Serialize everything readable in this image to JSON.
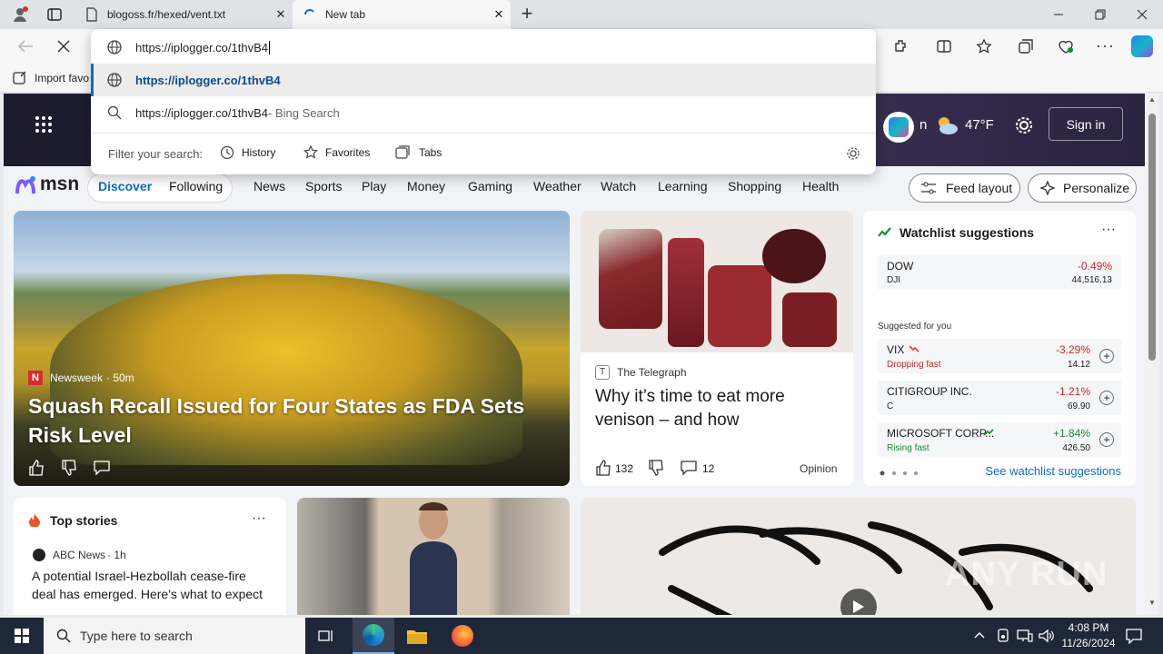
{
  "browser": {
    "tabs": [
      {
        "title": "blogoss.fr/hexed/vent.txt"
      },
      {
        "title": "New tab"
      }
    ],
    "address_text": "https://iplogger.co/1thvB4",
    "suggestions": [
      {
        "text": "https://iplogger.co/1thvB4",
        "suffix": ""
      },
      {
        "text": "https://iplogger.co/1thvB4",
        "suffix": " - Bing Search"
      }
    ],
    "filter_label": "Filter your search:",
    "filters": [
      "History",
      "Favorites",
      "Tabs"
    ],
    "favbar_item": "Import favo",
    "accent": "#0f6cbd"
  },
  "msn": {
    "logo": "msn",
    "sign_in": "Sign in",
    "weather_temp": "47°F",
    "sign_in_partial": "n",
    "nav": [
      "Discover",
      "Following",
      "News",
      "Sports",
      "Play",
      "Money",
      "Gaming",
      "Weather",
      "Watch",
      "Learning",
      "Shopping",
      "Health"
    ],
    "feed_layout": "Feed layout",
    "personalize": "Personalize",
    "lead": {
      "source": "Newsweek",
      "age": "· 50m",
      "headline": "Squash Recall Issued for Four States as FDA Sets Risk Level"
    },
    "second": {
      "source": "The Telegraph",
      "headline": "Why it’s time to eat more venison – and how",
      "likes": "132",
      "comments": "12",
      "tag": "Opinion"
    },
    "watchlist": {
      "title": "Watchlist suggestions",
      "suggested_label": "Suggested for you",
      "more_link": "See watchlist suggestions",
      "main": {
        "name": "DOW",
        "ticker": "DJI",
        "change": "-0.49%",
        "price": "44,516.13"
      },
      "items": [
        {
          "name": "VIX",
          "sub": "Dropping fast",
          "change": "-3.29%",
          "price": "14.12",
          "neg": true
        },
        {
          "name": "CITIGROUP INC.",
          "sub": "C",
          "change": "-1.21%",
          "price": "69.90",
          "neg": true
        },
        {
          "name": "MICROSOFT CORP...",
          "sub": "Rising fast",
          "change": "+1.84%",
          "price": "426.50",
          "neg": false
        }
      ]
    },
    "top_stories": {
      "title": "Top stories",
      "source": "ABC News",
      "age": "· 1h",
      "headline": "A potential Israel-Hezbollah cease-fire deal has emerged. Here's what to expect"
    }
  },
  "taskbar": {
    "search_placeholder": "Type here to search",
    "time": "4:08 PM",
    "date": "11/26/2024"
  },
  "watermark": "ANY RUN"
}
